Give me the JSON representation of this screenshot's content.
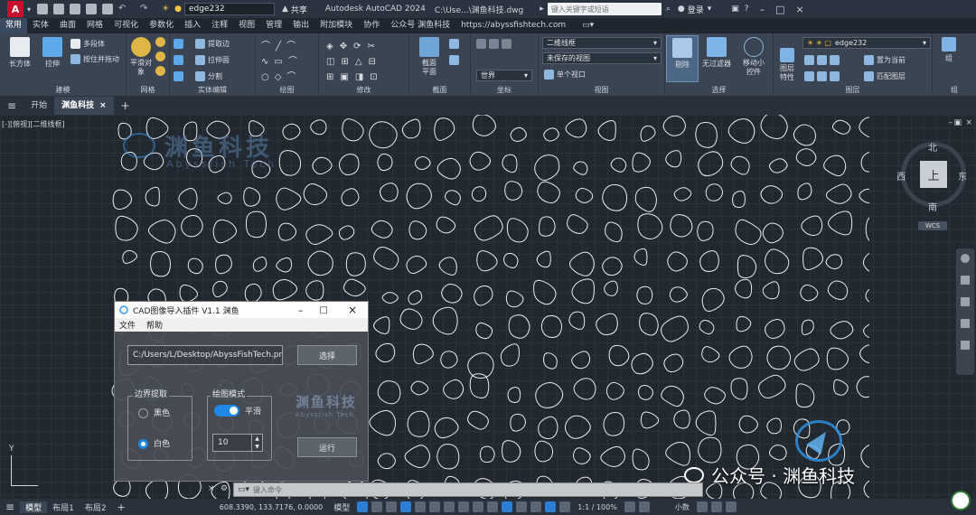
{
  "titlebar": {
    "workspace": "edge232",
    "share": "共享",
    "app_title": "Autodesk AutoCAD 2024",
    "file_title": "C:\\Use...\\渊鱼科技.dwg",
    "search_placeholder": "键入关键字或短语",
    "login": "登录"
  },
  "menu_tabs": [
    "常用",
    "实体",
    "曲面",
    "网格",
    "可视化",
    "参数化",
    "插入",
    "注释",
    "视图",
    "管理",
    "输出",
    "附加模块",
    "协作",
    "公众号 渊鱼科技",
    "https://abyssfishtech.com"
  ],
  "ribbon": {
    "modeling": {
      "title": "建模",
      "box": "长方体",
      "extrude": "拉伸",
      "polysolid": "多段体",
      "presspull": "按住并拖动"
    },
    "mesh": {
      "title": "网格",
      "smooth": "平滑对象"
    },
    "solid_edit": {
      "title": "实体编辑",
      "extract": "提取边",
      "extrude_face": "拉伸面",
      "separate": "分割"
    },
    "draw": {
      "title": "绘图"
    },
    "modify": {
      "title": "修改"
    },
    "section": {
      "title": "截面",
      "plane": "截面平面"
    },
    "coords": {
      "title": "坐标",
      "world": "世界"
    },
    "view": {
      "title": "视图",
      "style": "二维线框",
      "saved": "未保存的视图",
      "viewport": "单个视口"
    },
    "selection": {
      "title": "选择",
      "cull": "剔除",
      "nofilter": "无过滤器",
      "gizmo": "移动小控件"
    },
    "layers": {
      "title": "图层",
      "props": "图层特性",
      "layer": "edge232",
      "set_current": "置为当前",
      "match": "匹配图层"
    },
    "group": {
      "title": "组",
      "group": "组"
    }
  },
  "file_tabs": [
    "开始",
    "渊鱼科技"
  ],
  "viewport_label": "[-][俯视][二维线框]",
  "viewcube": {
    "north": "北",
    "south": "南",
    "east": "东",
    "west": "西",
    "top": "上",
    "wcs": "WCS"
  },
  "watermark": {
    "cn": "渊鱼科技",
    "en": "Abyssfish Tech"
  },
  "dialog": {
    "title": "CAD图像导入插件 V1.1 渊鱼",
    "menu_file": "文件",
    "menu_help": "帮助",
    "path": "C:/Users/L/Desktop/AbyssFishTech.png",
    "select_btn": "选择",
    "boundary_title": "边界提取",
    "black": "黑色",
    "white": "白色",
    "mode_title": "绘图模式",
    "smooth": "平滑",
    "smooth_value": "10",
    "run_btn": "运行"
  },
  "command_placeholder": "键入命令",
  "public_account": "公众号 · 渊鱼科技",
  "statusbar": {
    "model_tab": "模型",
    "layout1": "布局1",
    "layout2": "布局2",
    "coords": "608.3390, 133.7176, 0.0000",
    "model": "模型",
    "scale": "1:1 / 100%",
    "units": "小数"
  },
  "colors": {
    "accent": "#1e88e5",
    "bg": "#212830",
    "app_logo": "#c8102e"
  }
}
